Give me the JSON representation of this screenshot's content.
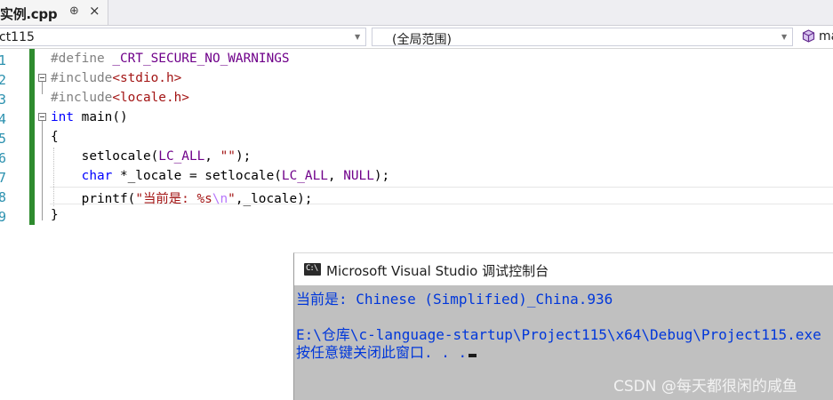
{
  "tab": {
    "label": "实例.cpp",
    "pin_glyph": "⊕",
    "close_glyph": "×"
  },
  "navbar": {
    "project": "ct115",
    "scope": "(全局范围)",
    "member": "ma",
    "arrow_glyph": "▼",
    "member_icon": "cube-icon"
  },
  "editor": {
    "line_numbers": [
      "1",
      "2",
      "3",
      "4",
      "5",
      "6",
      "7",
      "8",
      "9"
    ],
    "lines": [
      [
        {
          "t": "#define ",
          "c": "pp"
        },
        {
          "t": "_CRT_SECURE_NO_WARNINGS",
          "c": "macro"
        }
      ],
      [
        {
          "t": "#include",
          "c": "pp"
        },
        {
          "t": "<stdio.h>",
          "c": "str"
        }
      ],
      [
        {
          "t": "#include",
          "c": "pp"
        },
        {
          "t": "<locale.h>",
          "c": "str"
        }
      ],
      [
        {
          "t": "int",
          "c": "kw"
        },
        {
          "t": " main()",
          "c": "plain"
        }
      ],
      [
        {
          "t": "{",
          "c": "plain"
        }
      ],
      [
        {
          "t": "    setlocale(",
          "c": "plain"
        },
        {
          "t": "LC_ALL",
          "c": "macro"
        },
        {
          "t": ", ",
          "c": "plain"
        },
        {
          "t": "\"\"",
          "c": "str"
        },
        {
          "t": ");",
          "c": "plain"
        }
      ],
      [
        {
          "t": "    ",
          "c": "plain"
        },
        {
          "t": "char",
          "c": "kw"
        },
        {
          "t": " *_locale = setlocale(",
          "c": "plain"
        },
        {
          "t": "LC_ALL",
          "c": "macro"
        },
        {
          "t": ", ",
          "c": "plain"
        },
        {
          "t": "NULL",
          "c": "macro"
        },
        {
          "t": ");",
          "c": "plain"
        }
      ],
      [
        {
          "t": "    printf(",
          "c": "plain"
        },
        {
          "t": "\"当前是: %s",
          "c": "str"
        },
        {
          "t": "\\n",
          "c": "esc"
        },
        {
          "t": "\"",
          "c": "str"
        },
        {
          "t": ",_locale);",
          "c": "plain"
        }
      ],
      [
        {
          "t": "}",
          "c": "plain"
        }
      ]
    ]
  },
  "console": {
    "icon_text": "C:\\",
    "title": "Microsoft Visual Studio 调试控制台",
    "lines": [
      "当前是: Chinese (Simplified)_China.936",
      "",
      "E:\\仓库\\c-language-startup\\Project115\\x64\\Debug\\Project115.exe",
      "按任意键关闭此窗口. . ."
    ]
  },
  "watermark": "CSDN @每天都很闲的咸鱼"
}
